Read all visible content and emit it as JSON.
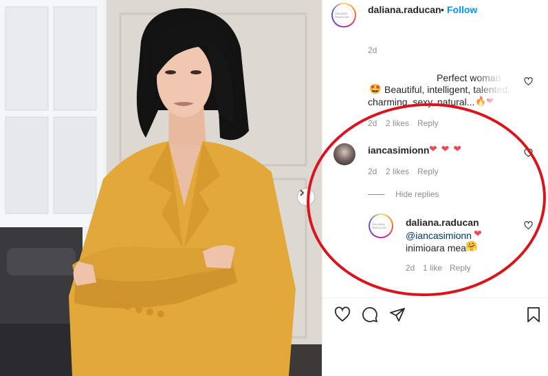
{
  "post": {
    "carousel_next_icon": "chevron-right-icon",
    "author": {
      "username": "daliana.raducan",
      "follow_label": "Follow",
      "avatar_text": "DALIANA RADUCAN"
    }
  },
  "comments": {
    "top_time": "2d",
    "first": {
      "line1": "Perfect woman",
      "more": "...",
      "line2": "Beautiful, intelligent, talented,",
      "line3": "charming, sexy, natural...",
      "time": "2d",
      "likes": "2 likes",
      "reply": "Reply"
    },
    "second": {
      "username": "iancasimionn",
      "emoji": "❤ ❤ ❤",
      "time": "2d",
      "likes": "2 likes",
      "reply": "Reply",
      "hide_replies": "Hide replies"
    },
    "reply": {
      "username": "daliana.raducan",
      "mention": "@iancasimionn",
      "heart": "❤",
      "text": "inimioara mea",
      "time": "2d",
      "likes": "1 like",
      "reply": "Reply"
    }
  },
  "icons": {
    "like": "heart-icon",
    "comment": "comment-icon",
    "share": "send-icon",
    "save": "bookmark-icon"
  },
  "colors": {
    "follow": "#0095f6",
    "heart_red": "#ed4956",
    "annotation": "#d9141c",
    "suit_yellow": "#e3a83a"
  }
}
